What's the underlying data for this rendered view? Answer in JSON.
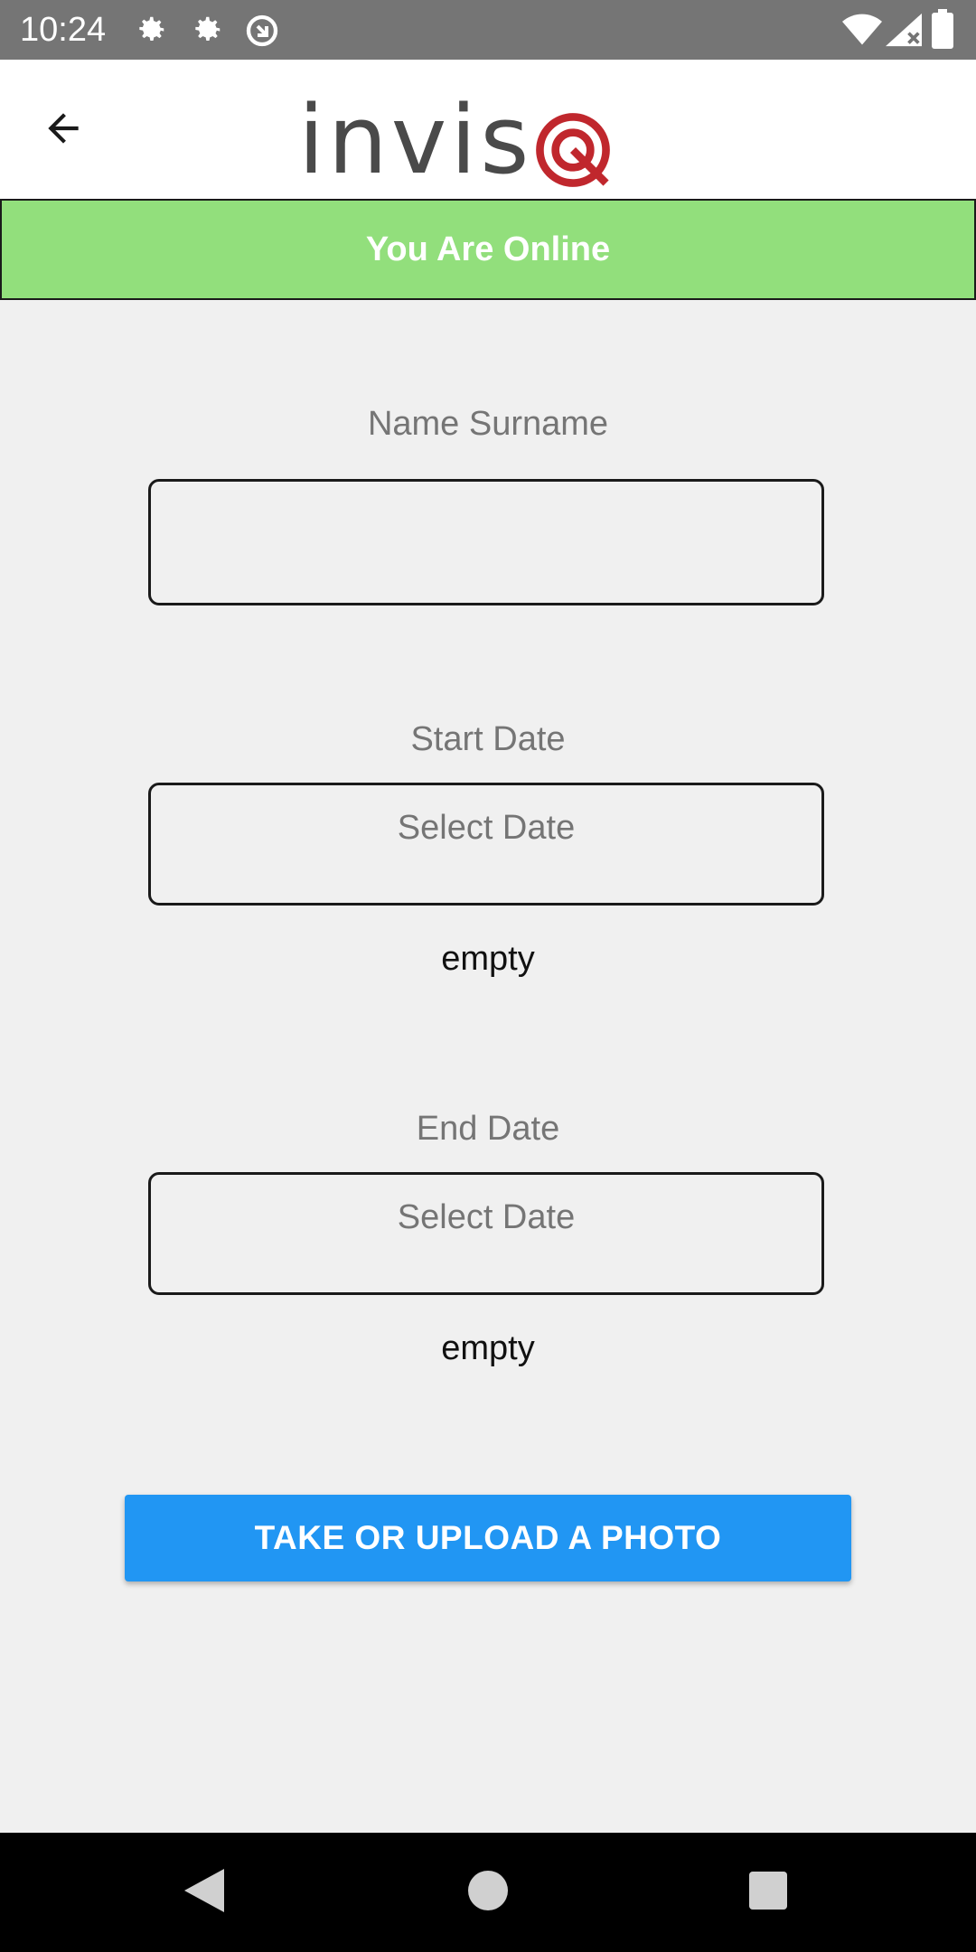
{
  "status_bar": {
    "time": "10:24",
    "icons": [
      "settings-icon",
      "settings-icon",
      "sync-icon",
      "wifi-icon",
      "signal-icon",
      "battery-icon"
    ]
  },
  "app_bar": {
    "back_icon": "arrow-left-icon",
    "logo_text": "invis",
    "logo_accent_color": "#c0272d"
  },
  "banner": {
    "text": "You Are Online",
    "color": "#92df7c"
  },
  "form": {
    "name_label": "Name Surname",
    "name_value": "",
    "start_date_label": "Start Date",
    "start_date_placeholder": "Select Date",
    "start_date_value": "empty",
    "end_date_label": "End Date",
    "end_date_placeholder": "Select Date",
    "end_date_value": "empty"
  },
  "actions": {
    "photo_button_label": "TAKE OR UPLOAD A PHOTO",
    "photo_button_color": "#2196f3"
  },
  "nav_bar": {
    "icons": [
      "back-triangle-icon",
      "home-circle-icon",
      "recents-square-icon"
    ]
  }
}
